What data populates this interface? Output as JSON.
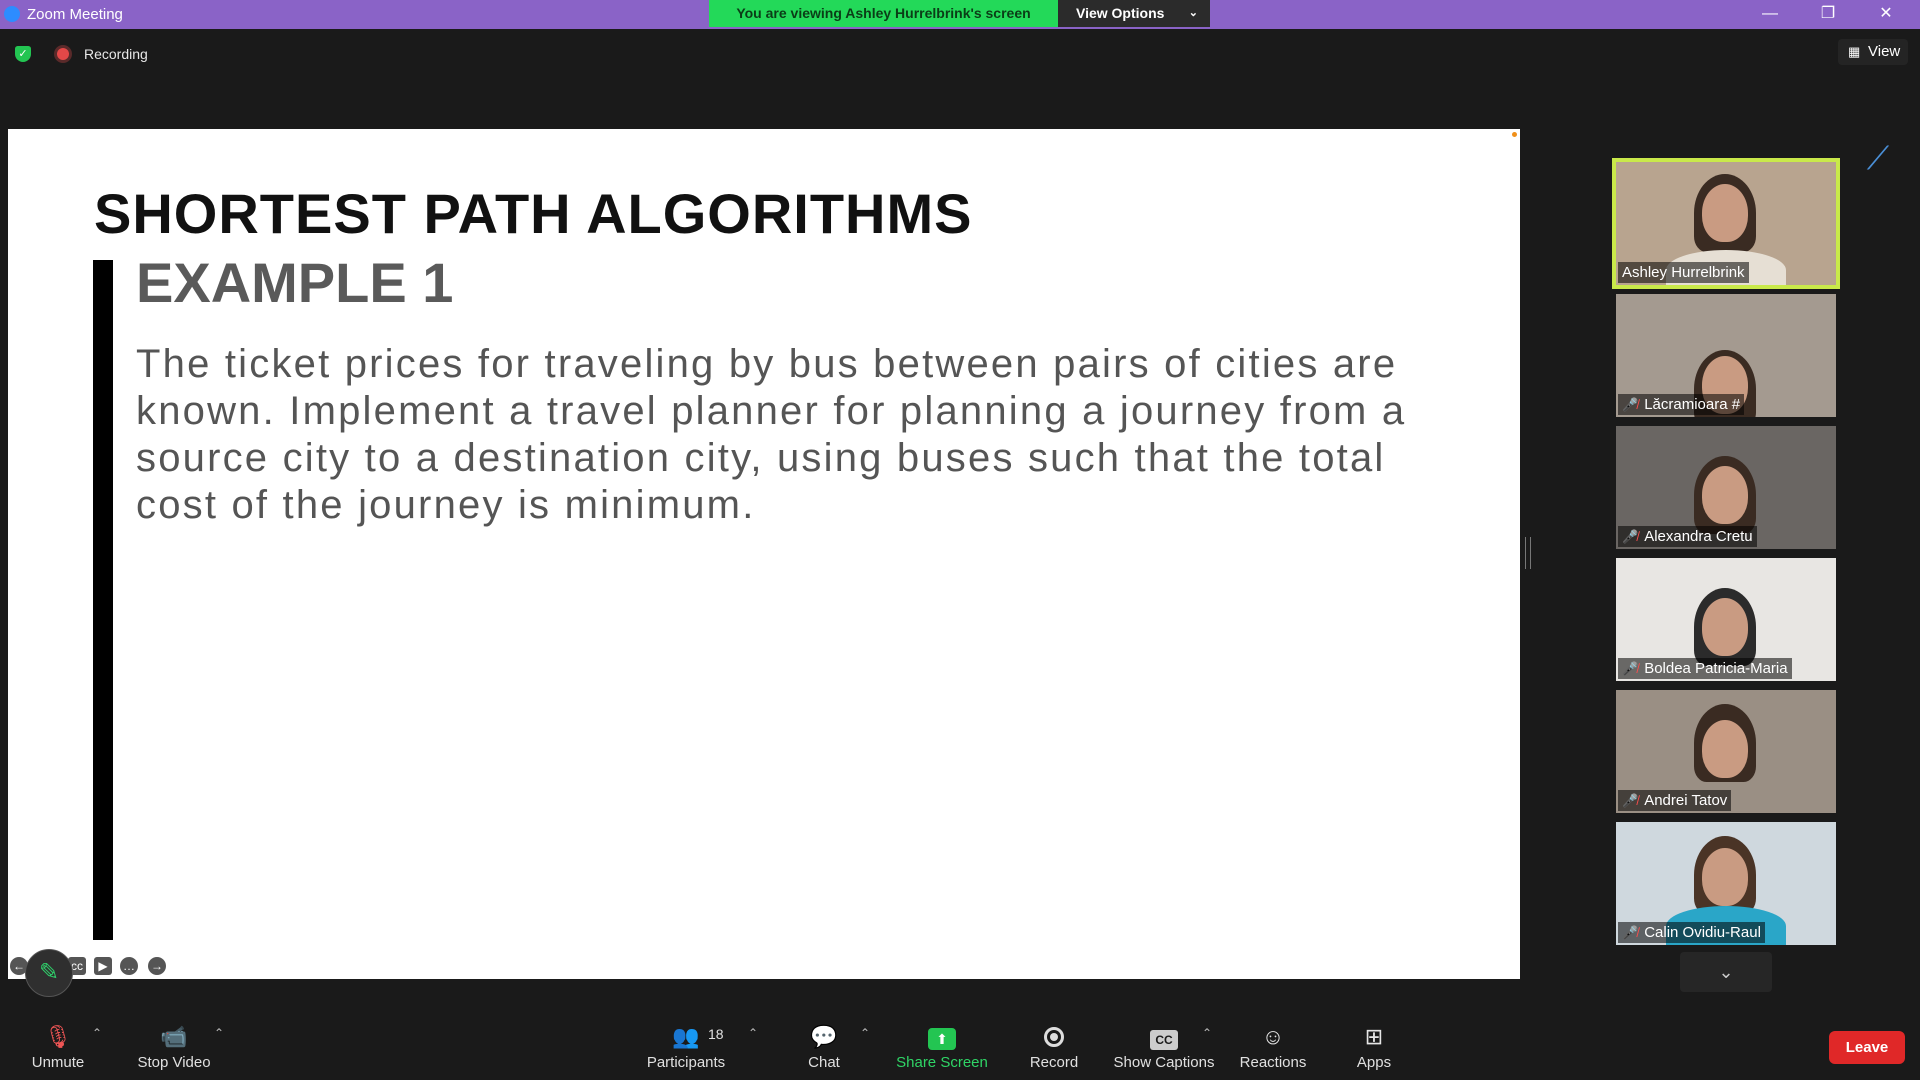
{
  "window": {
    "title": "Zoom Meeting"
  },
  "share": {
    "banner": "You are viewing Ashley Hurrelbrink's screen",
    "view_options": "View Options"
  },
  "status": {
    "recording": "Recording",
    "view": "View"
  },
  "slide": {
    "title": "SHORTEST PATH ALGORITHMS",
    "subtitle": "EXAMPLE 1",
    "body": "The ticket prices for traveling by bus between pairs of cities are known. Implement a travel planner for planning a journey from a source city to a destination city, using buses such that the total cost of the journey is minimum."
  },
  "gallery": [
    {
      "name": "Ashley Hurrelbrink",
      "muted": false,
      "active": true
    },
    {
      "name": "Lăcramioara #",
      "muted": true,
      "active": false
    },
    {
      "name": "Alexandra Cretu",
      "muted": true,
      "active": false
    },
    {
      "name": "Boldea Patricia-Maria",
      "muted": true,
      "active": false
    },
    {
      "name": "Andrei Tatov",
      "muted": true,
      "active": false
    },
    {
      "name": "Calin Ovidiu-Raul",
      "muted": true,
      "active": false
    }
  ],
  "toolbar": {
    "unmute": "Unmute",
    "stop_video": "Stop Video",
    "participants": "Participants",
    "participants_count": "18",
    "chat": "Chat",
    "share_screen": "Share Screen",
    "record": "Record",
    "show_captions": "Show Captions",
    "reactions": "Reactions",
    "apps": "Apps",
    "leave": "Leave"
  },
  "colors": {
    "title_bar": "#8a63c7",
    "share_banner": "#23d959",
    "leave": "#e02828",
    "active_speaker": "#c9e94a"
  },
  "icons": [
    "zoom-logo-icon",
    "shield-check-icon",
    "record-dot-icon",
    "grid-view-icon",
    "microphone-muted-icon",
    "video-camera-icon",
    "participants-icon",
    "chat-bubble-icon",
    "share-screen-icon",
    "record-icon",
    "closed-captions-icon",
    "reactions-icon",
    "apps-icon",
    "chevron-down-icon",
    "pen-icon"
  ]
}
